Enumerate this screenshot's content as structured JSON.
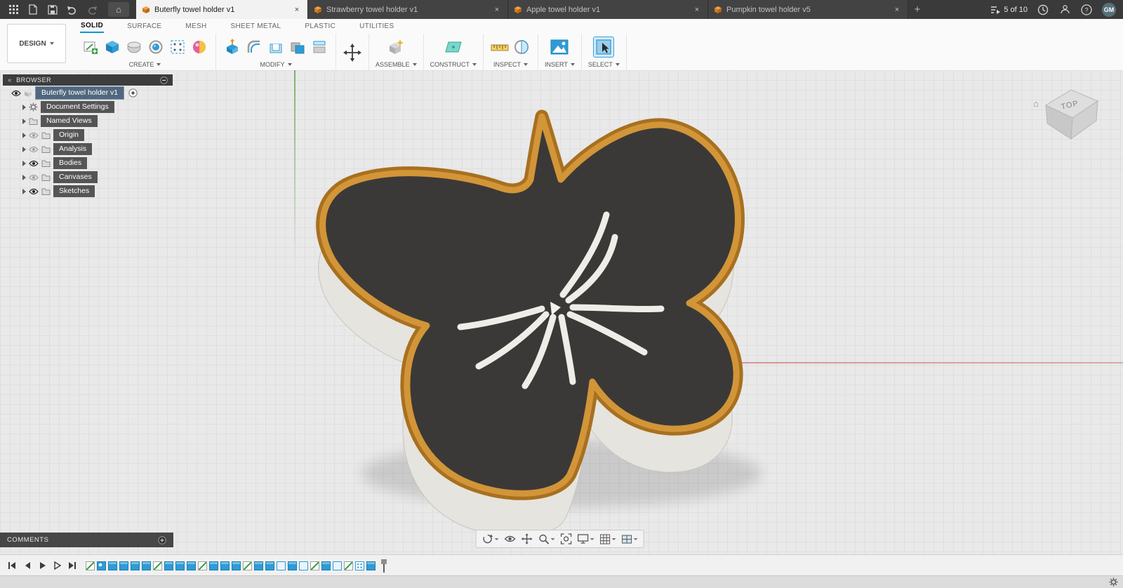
{
  "colors": {
    "accent_blue": "#0696d7",
    "model_top": "#3b3937",
    "model_rim": "#d29538",
    "model_rim_dark": "#a8701f",
    "model_side": "#e6e4de",
    "slot": "#efede7"
  },
  "titlebar": {
    "job_status": "5 of 10",
    "avatar_initials": "GM",
    "tabs": [
      {
        "label": "Buterfly towel holder v1",
        "active": true
      },
      {
        "label": "Strawberry towel holder v1",
        "active": false
      },
      {
        "label": "Apple towel holder v1",
        "active": false
      },
      {
        "label": "Pumpkin towel holder v5",
        "active": false
      }
    ]
  },
  "ribbon": {
    "workspace_label": "DESIGN",
    "tabs": [
      {
        "label": "SOLID",
        "active": true
      },
      {
        "label": "SURFACE",
        "active": false
      },
      {
        "label": "MESH",
        "active": false
      },
      {
        "label": "SHEET METAL",
        "active": false
      },
      {
        "label": "PLASTIC",
        "active": false
      },
      {
        "label": "UTILITIES",
        "active": false
      }
    ],
    "groups": [
      {
        "label": "CREATE"
      },
      {
        "label": "MODIFY"
      },
      {
        "label": "ASSEMBLE"
      },
      {
        "label": "CONSTRUCT"
      },
      {
        "label": "INSPECT"
      },
      {
        "label": "INSERT"
      },
      {
        "label": "SELECT"
      }
    ]
  },
  "browser": {
    "title": "BROWSER",
    "root_label": "Buterfly towel holder v1",
    "items": [
      {
        "label": "Document Settings",
        "icon": "gear",
        "eye": "none"
      },
      {
        "label": "Named Views",
        "icon": "folder",
        "eye": "none"
      },
      {
        "label": "Origin",
        "icon": "folder",
        "eye": "off"
      },
      {
        "label": "Analysis",
        "icon": "folder",
        "eye": "off"
      },
      {
        "label": "Bodies",
        "icon": "folder",
        "eye": "on"
      },
      {
        "label": "Canvases",
        "icon": "folder",
        "eye": "off"
      },
      {
        "label": "Sketches",
        "icon": "folder",
        "eye": "on"
      }
    ]
  },
  "viewport": {
    "viewcube_face": "TOP"
  },
  "comments": {
    "title": "COMMENTS"
  },
  "navbar": {
    "icons": [
      "orbit",
      "look-at",
      "pan",
      "zoom",
      "fit-view",
      "display-settings",
      "grid-settings",
      "viewports"
    ]
  },
  "timeline": {
    "icons": [
      "sketch",
      "canvas",
      "extrude",
      "extrude",
      "extrude",
      "extrude",
      "sketch",
      "extrude",
      "extrude",
      "extrude",
      "sketch",
      "extrude",
      "extrude",
      "extrude",
      "sketch",
      "extrude",
      "extrude",
      "box",
      "extrude",
      "box",
      "sketch",
      "extrude",
      "box",
      "sketch",
      "pattern",
      "extrude",
      "marker"
    ]
  },
  "icons": {
    "titlebar_left": [
      "app-grid",
      "file",
      "save",
      "undo",
      "redo",
      "home"
    ],
    "titlebar_right": [
      "job-status",
      "extensions",
      "notifications",
      "help"
    ],
    "viewcube": [
      "home",
      "top-face"
    ]
  }
}
